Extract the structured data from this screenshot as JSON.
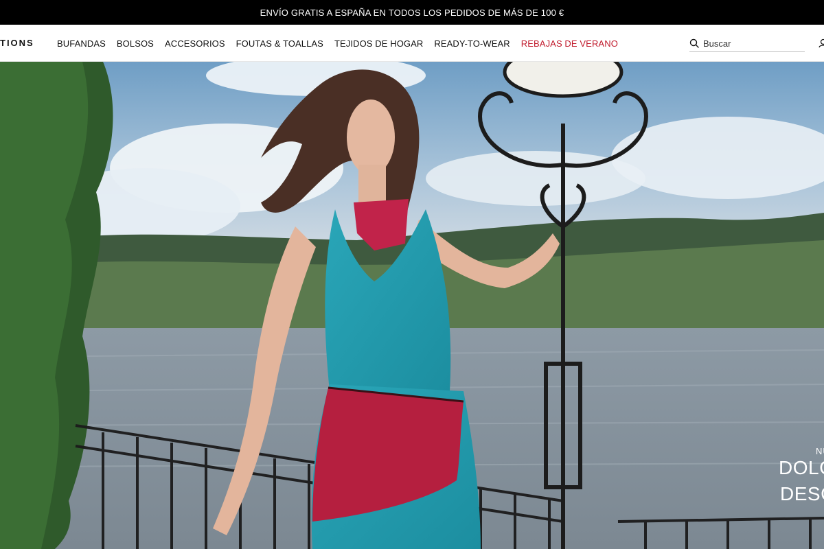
{
  "promo": {
    "text": "ENVÍO GRATIS A ESPAÑA EN TODOS LOS PEDIDOS DE MÁS DE 100 €"
  },
  "header": {
    "logo_text": "TIONS",
    "nav": [
      {
        "label": "BUFANDAS"
      },
      {
        "label": "BOLSOS"
      },
      {
        "label": "ACCESORIOS"
      },
      {
        "label": "FOUTAS & TOALLAS"
      },
      {
        "label": "TEJIDOS DE HOGAR"
      },
      {
        "label": "READY-TO-WEAR"
      },
      {
        "label": "REBAJAS DE VERANO"
      }
    ],
    "search": {
      "placeholder": "Buscar",
      "value": ""
    },
    "icons": {
      "search": "search-icon",
      "account": "user-icon"
    }
  },
  "hero": {
    "kicker": "NUEV",
    "title": "DOLCE",
    "cta": "DESCU"
  },
  "colors": {
    "promo_bg": "#000000",
    "sale": "#c0192b",
    "hero_text": "#ffffff"
  }
}
